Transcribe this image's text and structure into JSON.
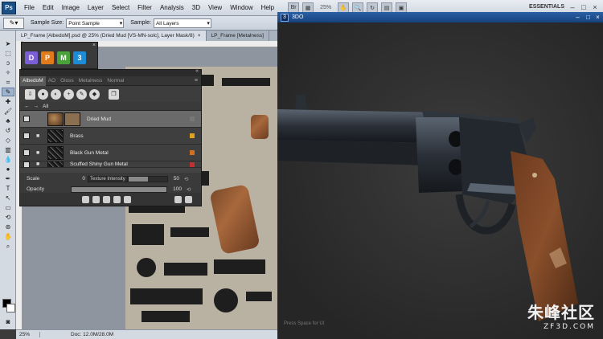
{
  "app": {
    "logo_text": "Ps",
    "menu": [
      "File",
      "Edit",
      "Image",
      "Layer",
      "Select",
      "Filter",
      "Analysis",
      "3D",
      "View",
      "Window",
      "Help"
    ],
    "zoom_readout": "25%",
    "workspace": "ESSENTIALS"
  },
  "options_bar": {
    "sample_size_label": "Sample Size:",
    "sample_size_value": "Point Sample",
    "sample_label": "Sample:",
    "sample_value": "All Layers"
  },
  "document_tabs": [
    {
      "label": "LP_Frame [AlbedoM].psd @ 25% (Dried Mud [VS-MN-solc], Layer Mask/8)",
      "close": "×"
    },
    {
      "label": "LP_Frame [Metalness]",
      "close": ""
    }
  ],
  "ddo_launcher": {
    "close": "×",
    "icons": [
      {
        "glyph": "D",
        "color": "#7b5dd6"
      },
      {
        "glyph": "P",
        "color": "#e07a1a"
      },
      {
        "glyph": "M",
        "color": "#4aa33a"
      },
      {
        "glyph": "3",
        "color": "#1e8bd6"
      }
    ]
  },
  "ddo_panel": {
    "tabs": [
      "AlbedoM",
      "AO",
      "Gloss",
      "Metalness",
      "Normal"
    ],
    "active_tab": "AlbedoM",
    "nav_label": "All",
    "layers": [
      {
        "name": "Dried Mud",
        "type": "material",
        "active": true
      },
      {
        "name": "Brass",
        "type": "folder",
        "active": false
      },
      {
        "name": "Black Gun Metal",
        "type": "folder",
        "active": false
      },
      {
        "name": "Scuffed Shiny Gun Metal",
        "type": "folder",
        "active": false
      }
    ],
    "properties": {
      "scale_label": "Scale",
      "scale_value": "0",
      "intensity_label": "Texture Intensity",
      "intensity_value": "50",
      "opacity_label": "Opacity",
      "opacity_value": "100"
    }
  },
  "status_bar": {
    "zoom": "25%",
    "doc": "Doc: 12.0M/28.0M"
  },
  "viewer": {
    "title": "3DO",
    "hint": "Press Space for UI"
  },
  "watermark": {
    "chinese": "朱峰社区",
    "domain": "ZF3D.COM"
  }
}
